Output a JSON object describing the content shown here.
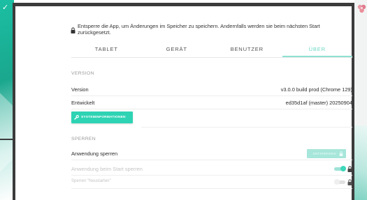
{
  "notice": {
    "text": "Entsperre die App, um Änderungen im Speicher zu speichern. Andernfalls werden sie beim nächsten Start zurückgesetzt."
  },
  "tabs": [
    {
      "label": "TABLET",
      "active": false
    },
    {
      "label": "GERÄT",
      "active": false
    },
    {
      "label": "BENUTZER",
      "active": false
    },
    {
      "label": "ÜBER",
      "active": true
    }
  ],
  "version_section": {
    "title": "VERSION",
    "rows": [
      {
        "label": "Version",
        "value": "v3.0.0 build prod (Chrome 129)"
      },
      {
        "label": "Entwickelt",
        "value": "ed35d1af (master) 20250904"
      }
    ],
    "sysinfo_button": "SYSTEMINFORMATIONEN"
  },
  "sperren_section": {
    "title": "SPERREN",
    "rows": [
      {
        "label": "Anwendung sperren",
        "button": "ENTSPERREN"
      },
      {
        "label": "Anwendung beim Start sperren",
        "toggle_on": true
      },
      {
        "label": "Sperren \"Neustarten\"",
        "toggle_on": false
      }
    ]
  },
  "colors": {
    "accent": "#2ed3b4",
    "accent_light": "#a7e6da",
    "tab_active": "#6bd8c4"
  },
  "icons": [
    "lock-icon",
    "wrench-icon",
    "check-icon",
    "flower-icon"
  ]
}
